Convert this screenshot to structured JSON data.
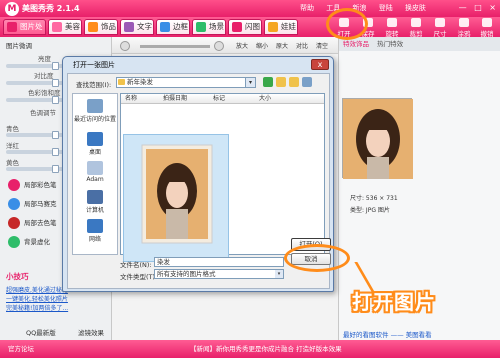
{
  "app": {
    "title": "美图秀秀 2.1.4",
    "menus": [
      "帮助",
      "工具",
      "新浪",
      "登陆",
      "换皮肤"
    ],
    "window_controls": [
      "—",
      "□",
      "×"
    ]
  },
  "tabs": [
    {
      "label": "图片处理",
      "color": "#e8206a"
    },
    {
      "label": "美容",
      "color": "#ff69a2"
    },
    {
      "label": "饰品",
      "color": "#ff8c1a"
    },
    {
      "label": "文字",
      "color": "#9b59b6"
    },
    {
      "label": "边框",
      "color": "#3a8ee6"
    },
    {
      "label": "场景",
      "color": "#2ebd6a"
    },
    {
      "label": "闪图",
      "color": "#e8206a"
    },
    {
      "label": "娃娃",
      "color": "#f5a623"
    }
  ],
  "toolbar": [
    {
      "label": "打开",
      "icon": "folder-icon"
    },
    {
      "label": "保存",
      "icon": "save-icon"
    },
    {
      "label": "旋转",
      "icon": "rotate-icon"
    },
    {
      "label": "裁剪",
      "icon": "crop-icon"
    },
    {
      "label": "尺寸",
      "icon": "resize-icon"
    },
    {
      "label": "涂鸦",
      "icon": "brush-icon"
    },
    {
      "label": "撤销",
      "icon": "undo-icon"
    }
  ],
  "subbar": {
    "buttons": [
      "放大",
      "缩小",
      "原大",
      "对比",
      "清空"
    ]
  },
  "left_panel": {
    "title": "图片微调",
    "sliders": [
      "亮度",
      "对比度",
      "色彩饱和度",
      "色调调节",
      "青色",
      "洋红",
      "黄色"
    ],
    "buttons": [
      "局部彩色笔",
      "局部马赛克",
      "局部去色笔",
      "背景虚化"
    ],
    "tips_title": "小技巧",
    "tips": [
      "超强磨皮,美化通过秘籍",
      "一键美化,轻松美化照片",
      "完美秘籍!加两倍多了..."
    ]
  },
  "right_panel": {
    "header": [
      "特效饰品",
      "热门特效"
    ],
    "footer": "最好的看图软件 —— 美图看看"
  },
  "dialog": {
    "title": "打开一张图片",
    "lookin_label": "查找范围(I):",
    "lookin_value": "新年染发",
    "columns": [
      "名称",
      "拍摄日期",
      "标记",
      "大小"
    ],
    "places": [
      "最近访问的位置",
      "桌面",
      "Adam",
      "计算机",
      "网络"
    ],
    "filename_label": "文件名(N):",
    "filename_value": "染发",
    "filetype_label": "文件类型(T):",
    "filetype_value": "所有支持的图片格式",
    "open_button": "打开(O)",
    "cancel_button": "取消",
    "close_label": "x"
  },
  "preview": {
    "size_label": "尺寸: 536 × 731",
    "type_label": "类型: JPG 图片"
  },
  "status": {
    "left": "官方论坛",
    "qq": "QQ最新版",
    "tag": "滤镜效果",
    "center": "【新闻】新你用秀秀更是你成片融合 打造好版本效果"
  },
  "annotation": {
    "big_label": "打开图片"
  }
}
